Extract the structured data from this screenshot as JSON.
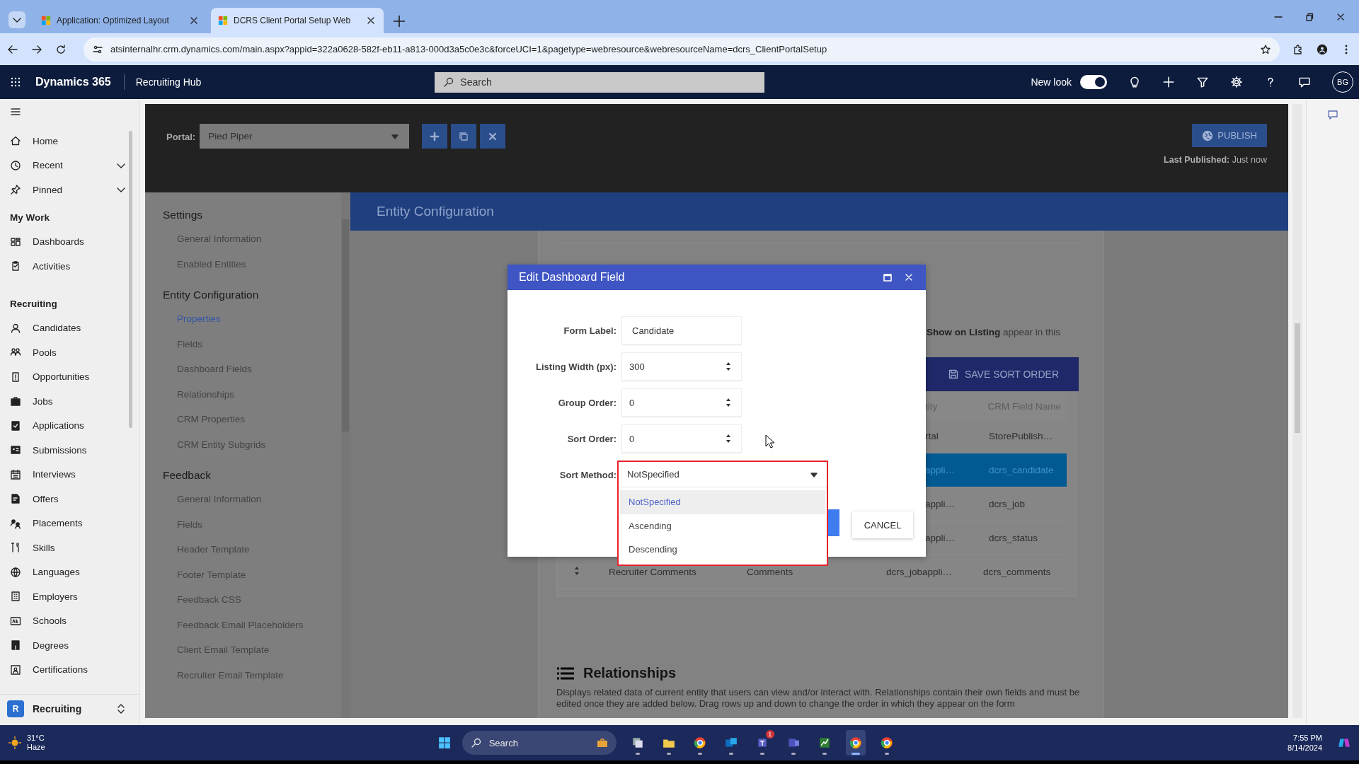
{
  "browser": {
    "tabs": [
      {
        "title": "Application: Optimized Layout",
        "selected": false
      },
      {
        "title": "DCRS Client Portal Setup Web",
        "selected": true
      }
    ],
    "url": "atsinternalhr.crm.dynamics.com/main.aspx?appid=322a0628-582f-eb11-a813-000d3a5c0e3c&forceUCI=1&pagetype=webresource&webresourceName=dcrs_ClientPortalSetup"
  },
  "app_header": {
    "product": "Dynamics 365",
    "app": "Recruiting Hub",
    "search_placeholder": "Search",
    "new_look_label": "New look",
    "new_look_on": true,
    "avatar": "BG"
  },
  "sidebar": {
    "top_items": [
      {
        "label": "Home",
        "expandable": false
      },
      {
        "label": "Recent",
        "expandable": true
      },
      {
        "label": "Pinned",
        "expandable": true
      }
    ],
    "groups": [
      {
        "title": "My Work",
        "items": [
          "Dashboards",
          "Activities"
        ]
      },
      {
        "title": "Recruiting",
        "items": [
          "Candidates",
          "Pools",
          "Opportunities",
          "Jobs",
          "Applications",
          "Submissions",
          "Interviews",
          "Offers",
          "Placements",
          "Skills",
          "Languages",
          "Employers",
          "Schools",
          "Degrees",
          "Certifications"
        ]
      }
    ],
    "area_switcher": {
      "badge": "R",
      "label": "Recruiting"
    }
  },
  "portal_bar": {
    "label": "Portal:",
    "portal": "Pied Piper",
    "publish": "PUBLISH",
    "last_published_label": "Last Published:",
    "last_published": "Just now"
  },
  "settings_nav": [
    {
      "title": "Settings",
      "items": [
        {
          "label": "General Information",
          "selected": false
        },
        {
          "label": "Enabled Entities",
          "selected": false
        }
      ]
    },
    {
      "title": "Entity Configuration",
      "items": [
        {
          "label": "Properties",
          "selected": true
        },
        {
          "label": "Fields",
          "selected": false
        },
        {
          "label": "Dashboard Fields",
          "selected": false
        },
        {
          "label": "Relationships",
          "selected": false
        },
        {
          "label": "CRM Properties",
          "selected": false
        },
        {
          "label": "CRM Entity Subgrids",
          "selected": false
        }
      ]
    },
    {
      "title": "Feedback",
      "items": [
        {
          "label": "General Information",
          "selected": false
        },
        {
          "label": "Fields",
          "selected": false
        },
        {
          "label": "Header Template",
          "selected": false
        },
        {
          "label": "Footer Template",
          "selected": false
        },
        {
          "label": "Feedback CSS",
          "selected": false
        },
        {
          "label": "Feedback Email Placeholders",
          "selected": false
        },
        {
          "label": "Client Email Template",
          "selected": false
        },
        {
          "label": "Recruiter Email Template",
          "selected": false
        }
      ]
    }
  ],
  "section_title": "Entity Configuration",
  "listing_note": "**Show on Listing** appear in this",
  "save_sort_order": "SAVE SORT ORDER",
  "table": {
    "columns": [
      "tity",
      "CRM Field Name"
    ],
    "rows": [
      {
        "covered": true,
        "selected": false,
        "cells": [
          "rtal",
          "StorePublish…"
        ]
      },
      {
        "covered": true,
        "selected": true,
        "cells": [
          "appli…",
          "dcrs_candidate"
        ]
      },
      {
        "covered": true,
        "selected": false,
        "cells": [
          "appli…",
          "dcrs_job"
        ]
      },
      {
        "covered": true,
        "selected": false,
        "cells": [
          "appli…",
          "dcrs_status"
        ]
      },
      {
        "covered": false,
        "selected": false,
        "cells": [
          "Recruiter Comments",
          "Comments",
          "dcrs_jobappli…",
          "dcrs_comments"
        ]
      }
    ]
  },
  "relationships": {
    "title": "Relationships",
    "description": "Displays related data of current entity that users can view and/or interact with. Relationships contain their own fields and must be edited once they are added below. Drag rows up and down to change the order in which they appear on the form"
  },
  "dialog": {
    "title": "Edit Dashboard Field",
    "fields": [
      {
        "label": "Form Label:",
        "kind": "text",
        "value": "Candidate"
      },
      {
        "label": "Listing Width (px):",
        "kind": "number",
        "value": "300"
      },
      {
        "label": "Group Order:",
        "kind": "number",
        "value": "0"
      },
      {
        "label": "Sort Order:",
        "kind": "number",
        "value": "0"
      },
      {
        "label": "Sort Method:",
        "kind": "select",
        "value": "NotSpecified",
        "expanded": true,
        "options": [
          {
            "label": "NotSpecified",
            "selected": true
          },
          {
            "label": "Ascending",
            "selected": false
          },
          {
            "label": "Descending",
            "selected": false
          }
        ]
      }
    ],
    "cancel": "CANCEL"
  },
  "taskbar": {
    "temperature": "31°C",
    "weather": "Haze",
    "search_placeholder": "Search",
    "apps": [
      {
        "active": false
      },
      {
        "active": false
      },
      {
        "active": false
      },
      {
        "active": false
      },
      {
        "active": false,
        "badge": "1"
      },
      {
        "active": false
      },
      {
        "active": false
      },
      {
        "active": true
      },
      {
        "active": false
      }
    ],
    "time": "7:55 PM",
    "date": "8/14/2024"
  }
}
